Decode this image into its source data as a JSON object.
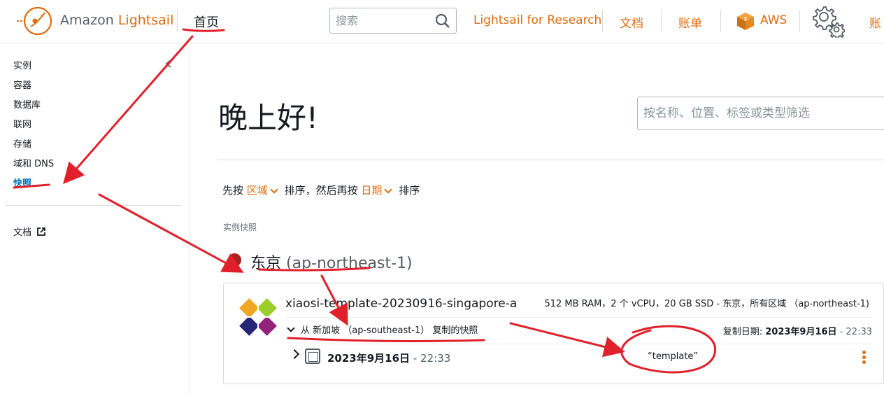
{
  "header": {
    "brand_prefix": "Amazon",
    "brand_suffix": "Lightsail",
    "home": "首页",
    "search_placeholder": "搜索",
    "links": {
      "research": "Lightsail for Research",
      "docs": "文档",
      "billing": "账单",
      "aws": "AWS",
      "account": "账"
    }
  },
  "sidebar": {
    "items": [
      "实例",
      "容器",
      "数据库",
      "联网",
      "存储",
      "域和 DNS",
      "快照"
    ],
    "active_index": 6,
    "docs_label": "文档"
  },
  "main": {
    "greeting": "晚上好!",
    "filter_placeholder": "按名称、位置、标签或类型筛选",
    "sort": {
      "prefix": "先按",
      "first": "区域",
      "middle": "排序，然后再按",
      "second": "日期",
      "suffix": "排序"
    },
    "section_label": "实例快照",
    "region": {
      "name": "东京",
      "code": "(ap-northeast-1)"
    },
    "snapshot": {
      "name": "xiaosi-template-20230916-singapore-a",
      "spec": "512 MB RAM，2 个 vCPU，20 GB SSD - 东京，所有区域 （ap-northeast-1)",
      "copy_text": "从 新加坡 （ap-southeast-1） 复制的快照",
      "copy_date_label": "复制日期:",
      "copy_date": "2023年9月16日",
      "copy_time": "- 22:33",
      "row_date": "2023年9月16日",
      "row_time": "- 22:33",
      "tag": "“template”"
    }
  },
  "colors": {
    "accent": "#dd6b10",
    "active_nav": "#0073bb",
    "region_dot": "#a6231e",
    "annotation": "#e0202a"
  }
}
